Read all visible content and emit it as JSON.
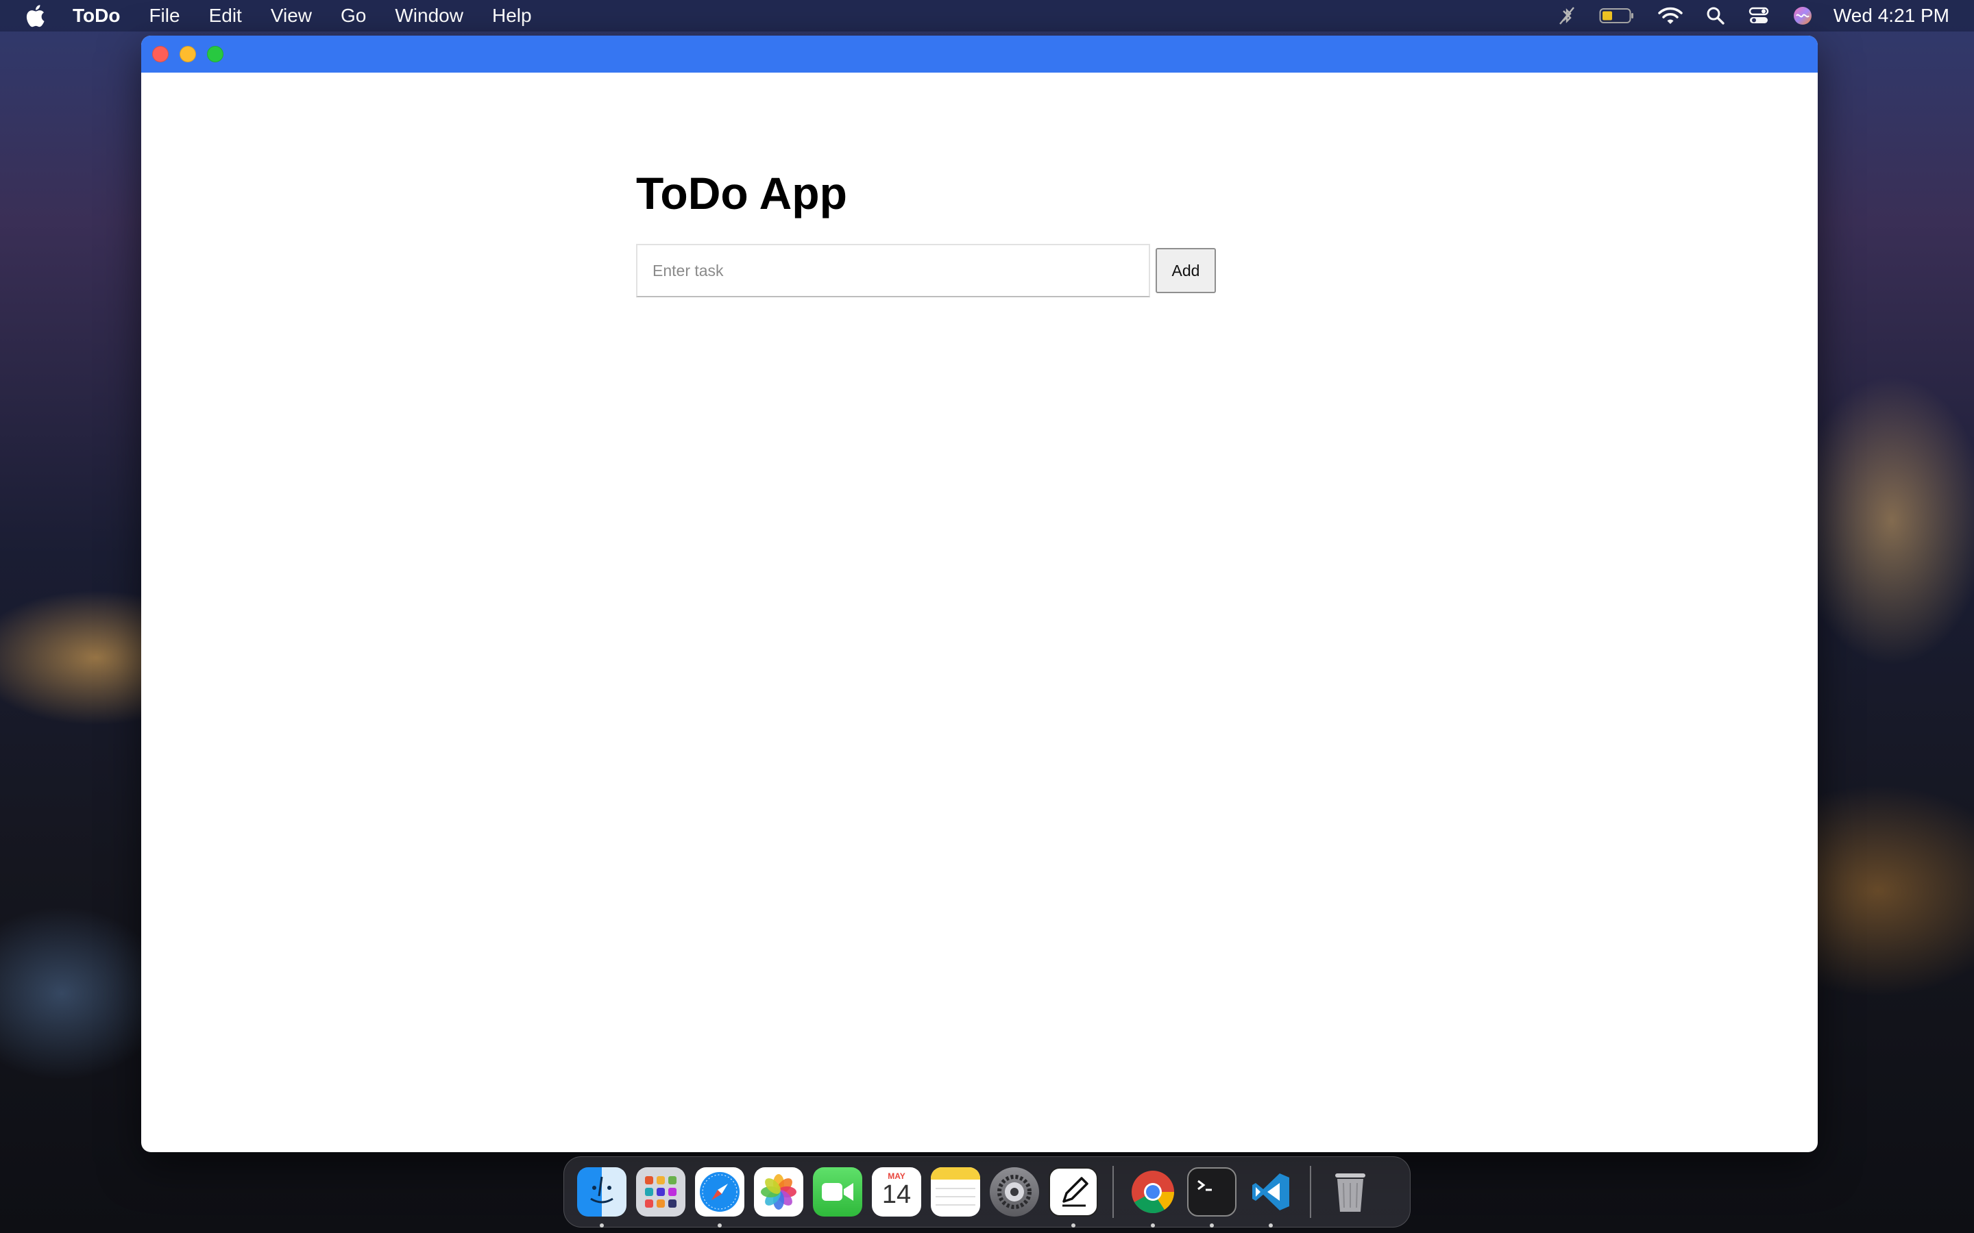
{
  "menubar": {
    "app_name": "ToDo",
    "items": [
      "File",
      "Edit",
      "View",
      "Go",
      "Window",
      "Help"
    ],
    "status_icons": [
      "no-bluetooth-icon",
      "battery-icon",
      "wifi-icon",
      "spotlight-icon",
      "control-center-icon",
      "siri-icon"
    ],
    "clock": "Wed 4:21 PM"
  },
  "window": {
    "titlebar_color": "#3676f2",
    "heading": "ToDo App",
    "input": {
      "placeholder": "Enter task",
      "value": ""
    },
    "add_label": "Add"
  },
  "dock": {
    "apps": [
      {
        "name": "finder-icon",
        "running": true
      },
      {
        "name": "launchpad-icon",
        "running": false
      },
      {
        "name": "safari-icon",
        "running": true
      },
      {
        "name": "photos-icon",
        "running": false
      },
      {
        "name": "facetime-icon",
        "running": false
      },
      {
        "name": "calendar-icon",
        "running": false
      },
      {
        "name": "notes-icon",
        "running": false
      },
      {
        "name": "system-settings-icon",
        "running": false
      },
      {
        "name": "textedit-icon",
        "running": true
      },
      {
        "name": "chrome-icon",
        "running": true
      },
      {
        "name": "terminal-icon",
        "running": true
      },
      {
        "name": "vscode-icon",
        "running": true
      },
      {
        "name": "trash-icon",
        "running": false
      }
    ],
    "calendar": {
      "month": "MAY",
      "day": "14"
    }
  }
}
